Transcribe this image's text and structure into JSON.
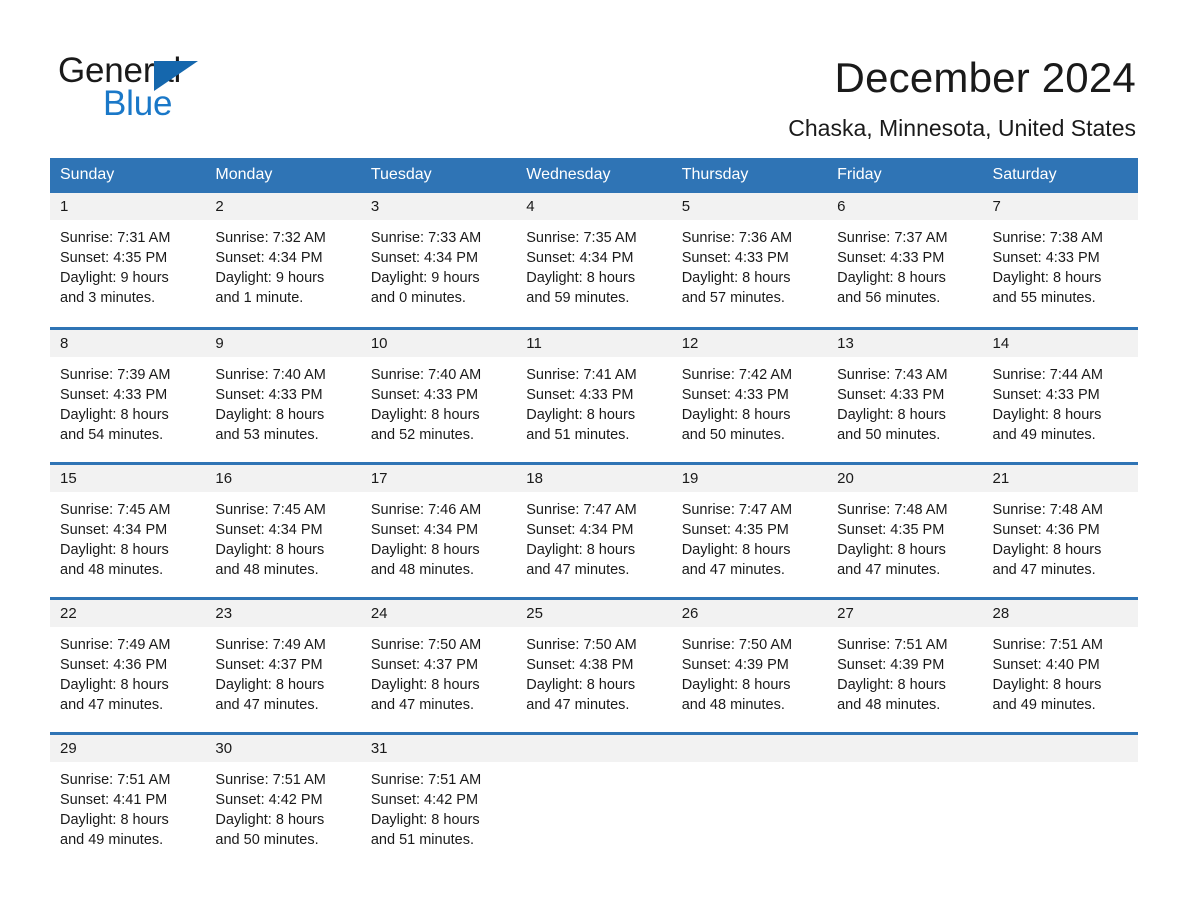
{
  "brand": {
    "name_part1": "General",
    "name_part2": "Blue",
    "triangle_color": "#1567ad",
    "blue_color": "#1a78c8"
  },
  "header": {
    "month_title": "December 2024",
    "location": "Chaska, Minnesota, United States"
  },
  "theme": {
    "header_blue": "#2f74b5",
    "daynum_gray": "#f2f2f2",
    "text_color": "#1a1a1a"
  },
  "weekdays": [
    "Sunday",
    "Monday",
    "Tuesday",
    "Wednesday",
    "Thursday",
    "Friday",
    "Saturday"
  ],
  "weeks": [
    [
      {
        "day": "1",
        "sunrise": "Sunrise: 7:31 AM",
        "sunset": "Sunset: 4:35 PM",
        "daylight_line1": "Daylight: 9 hours",
        "daylight_line2": "and 3 minutes."
      },
      {
        "day": "2",
        "sunrise": "Sunrise: 7:32 AM",
        "sunset": "Sunset: 4:34 PM",
        "daylight_line1": "Daylight: 9 hours",
        "daylight_line2": "and 1 minute."
      },
      {
        "day": "3",
        "sunrise": "Sunrise: 7:33 AM",
        "sunset": "Sunset: 4:34 PM",
        "daylight_line1": "Daylight: 9 hours",
        "daylight_line2": "and 0 minutes."
      },
      {
        "day": "4",
        "sunrise": "Sunrise: 7:35 AM",
        "sunset": "Sunset: 4:34 PM",
        "daylight_line1": "Daylight: 8 hours",
        "daylight_line2": "and 59 minutes."
      },
      {
        "day": "5",
        "sunrise": "Sunrise: 7:36 AM",
        "sunset": "Sunset: 4:33 PM",
        "daylight_line1": "Daylight: 8 hours",
        "daylight_line2": "and 57 minutes."
      },
      {
        "day": "6",
        "sunrise": "Sunrise: 7:37 AM",
        "sunset": "Sunset: 4:33 PM",
        "daylight_line1": "Daylight: 8 hours",
        "daylight_line2": "and 56 minutes."
      },
      {
        "day": "7",
        "sunrise": "Sunrise: 7:38 AM",
        "sunset": "Sunset: 4:33 PM",
        "daylight_line1": "Daylight: 8 hours",
        "daylight_line2": "and 55 minutes."
      }
    ],
    [
      {
        "day": "8",
        "sunrise": "Sunrise: 7:39 AM",
        "sunset": "Sunset: 4:33 PM",
        "daylight_line1": "Daylight: 8 hours",
        "daylight_line2": "and 54 minutes."
      },
      {
        "day": "9",
        "sunrise": "Sunrise: 7:40 AM",
        "sunset": "Sunset: 4:33 PM",
        "daylight_line1": "Daylight: 8 hours",
        "daylight_line2": "and 53 minutes."
      },
      {
        "day": "10",
        "sunrise": "Sunrise: 7:40 AM",
        "sunset": "Sunset: 4:33 PM",
        "daylight_line1": "Daylight: 8 hours",
        "daylight_line2": "and 52 minutes."
      },
      {
        "day": "11",
        "sunrise": "Sunrise: 7:41 AM",
        "sunset": "Sunset: 4:33 PM",
        "daylight_line1": "Daylight: 8 hours",
        "daylight_line2": "and 51 minutes."
      },
      {
        "day": "12",
        "sunrise": "Sunrise: 7:42 AM",
        "sunset": "Sunset: 4:33 PM",
        "daylight_line1": "Daylight: 8 hours",
        "daylight_line2": "and 50 minutes."
      },
      {
        "day": "13",
        "sunrise": "Sunrise: 7:43 AM",
        "sunset": "Sunset: 4:33 PM",
        "daylight_line1": "Daylight: 8 hours",
        "daylight_line2": "and 50 minutes."
      },
      {
        "day": "14",
        "sunrise": "Sunrise: 7:44 AM",
        "sunset": "Sunset: 4:33 PM",
        "daylight_line1": "Daylight: 8 hours",
        "daylight_line2": "and 49 minutes."
      }
    ],
    [
      {
        "day": "15",
        "sunrise": "Sunrise: 7:45 AM",
        "sunset": "Sunset: 4:34 PM",
        "daylight_line1": "Daylight: 8 hours",
        "daylight_line2": "and 48 minutes."
      },
      {
        "day": "16",
        "sunrise": "Sunrise: 7:45 AM",
        "sunset": "Sunset: 4:34 PM",
        "daylight_line1": "Daylight: 8 hours",
        "daylight_line2": "and 48 minutes."
      },
      {
        "day": "17",
        "sunrise": "Sunrise: 7:46 AM",
        "sunset": "Sunset: 4:34 PM",
        "daylight_line1": "Daylight: 8 hours",
        "daylight_line2": "and 48 minutes."
      },
      {
        "day": "18",
        "sunrise": "Sunrise: 7:47 AM",
        "sunset": "Sunset: 4:34 PM",
        "daylight_line1": "Daylight: 8 hours",
        "daylight_line2": "and 47 minutes."
      },
      {
        "day": "19",
        "sunrise": "Sunrise: 7:47 AM",
        "sunset": "Sunset: 4:35 PM",
        "daylight_line1": "Daylight: 8 hours",
        "daylight_line2": "and 47 minutes."
      },
      {
        "day": "20",
        "sunrise": "Sunrise: 7:48 AM",
        "sunset": "Sunset: 4:35 PM",
        "daylight_line1": "Daylight: 8 hours",
        "daylight_line2": "and 47 minutes."
      },
      {
        "day": "21",
        "sunrise": "Sunrise: 7:48 AM",
        "sunset": "Sunset: 4:36 PM",
        "daylight_line1": "Daylight: 8 hours",
        "daylight_line2": "and 47 minutes."
      }
    ],
    [
      {
        "day": "22",
        "sunrise": "Sunrise: 7:49 AM",
        "sunset": "Sunset: 4:36 PM",
        "daylight_line1": "Daylight: 8 hours",
        "daylight_line2": "and 47 minutes."
      },
      {
        "day": "23",
        "sunrise": "Sunrise: 7:49 AM",
        "sunset": "Sunset: 4:37 PM",
        "daylight_line1": "Daylight: 8 hours",
        "daylight_line2": "and 47 minutes."
      },
      {
        "day": "24",
        "sunrise": "Sunrise: 7:50 AM",
        "sunset": "Sunset: 4:37 PM",
        "daylight_line1": "Daylight: 8 hours",
        "daylight_line2": "and 47 minutes."
      },
      {
        "day": "25",
        "sunrise": "Sunrise: 7:50 AM",
        "sunset": "Sunset: 4:38 PM",
        "daylight_line1": "Daylight: 8 hours",
        "daylight_line2": "and 47 minutes."
      },
      {
        "day": "26",
        "sunrise": "Sunrise: 7:50 AM",
        "sunset": "Sunset: 4:39 PM",
        "daylight_line1": "Daylight: 8 hours",
        "daylight_line2": "and 48 minutes."
      },
      {
        "day": "27",
        "sunrise": "Sunrise: 7:51 AM",
        "sunset": "Sunset: 4:39 PM",
        "daylight_line1": "Daylight: 8 hours",
        "daylight_line2": "and 48 minutes."
      },
      {
        "day": "28",
        "sunrise": "Sunrise: 7:51 AM",
        "sunset": "Sunset: 4:40 PM",
        "daylight_line1": "Daylight: 8 hours",
        "daylight_line2": "and 49 minutes."
      }
    ],
    [
      {
        "day": "29",
        "sunrise": "Sunrise: 7:51 AM",
        "sunset": "Sunset: 4:41 PM",
        "daylight_line1": "Daylight: 8 hours",
        "daylight_line2": "and 49 minutes."
      },
      {
        "day": "30",
        "sunrise": "Sunrise: 7:51 AM",
        "sunset": "Sunset: 4:42 PM",
        "daylight_line1": "Daylight: 8 hours",
        "daylight_line2": "and 50 minutes."
      },
      {
        "day": "31",
        "sunrise": "Sunrise: 7:51 AM",
        "sunset": "Sunset: 4:42 PM",
        "daylight_line1": "Daylight: 8 hours",
        "daylight_line2": "and 51 minutes."
      },
      {
        "day": "",
        "sunrise": "",
        "sunset": "",
        "daylight_line1": "",
        "daylight_line2": ""
      },
      {
        "day": "",
        "sunrise": "",
        "sunset": "",
        "daylight_line1": "",
        "daylight_line2": ""
      },
      {
        "day": "",
        "sunrise": "",
        "sunset": "",
        "daylight_line1": "",
        "daylight_line2": ""
      },
      {
        "day": "",
        "sunrise": "",
        "sunset": "",
        "daylight_line1": "",
        "daylight_line2": ""
      }
    ]
  ]
}
